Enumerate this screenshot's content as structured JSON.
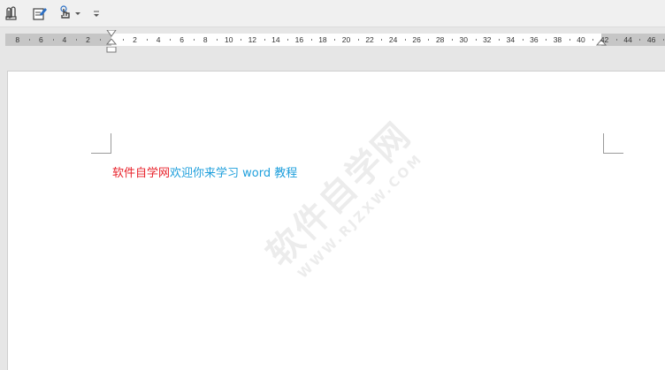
{
  "toolbar": {
    "buttons": [
      {
        "icon": "attach-icon"
      },
      {
        "icon": "edit-document-icon"
      },
      {
        "icon": "touch-mode-icon"
      },
      {
        "icon": "customize-toolbar-icon"
      }
    ]
  },
  "ruler": {
    "left_labels": [
      "8",
      "6",
      "4",
      "2"
    ],
    "right_labels": [
      "2",
      "4",
      "6",
      "8",
      "10",
      "12",
      "14",
      "16",
      "18",
      "20",
      "22",
      "24",
      "26",
      "28",
      "30",
      "32",
      "34",
      "36",
      "38",
      "40"
    ],
    "margin_labels": [
      "42",
      "44",
      "46"
    ]
  },
  "document": {
    "text_red": "软件自学网",
    "text_blue": "欢迎你来学习 word 教程",
    "colors": {
      "red": "#e8212a",
      "blue": "#1e9fdc"
    }
  },
  "watermark": {
    "main": "软件自学网",
    "sub": "WWW.RJZXW.COM"
  }
}
